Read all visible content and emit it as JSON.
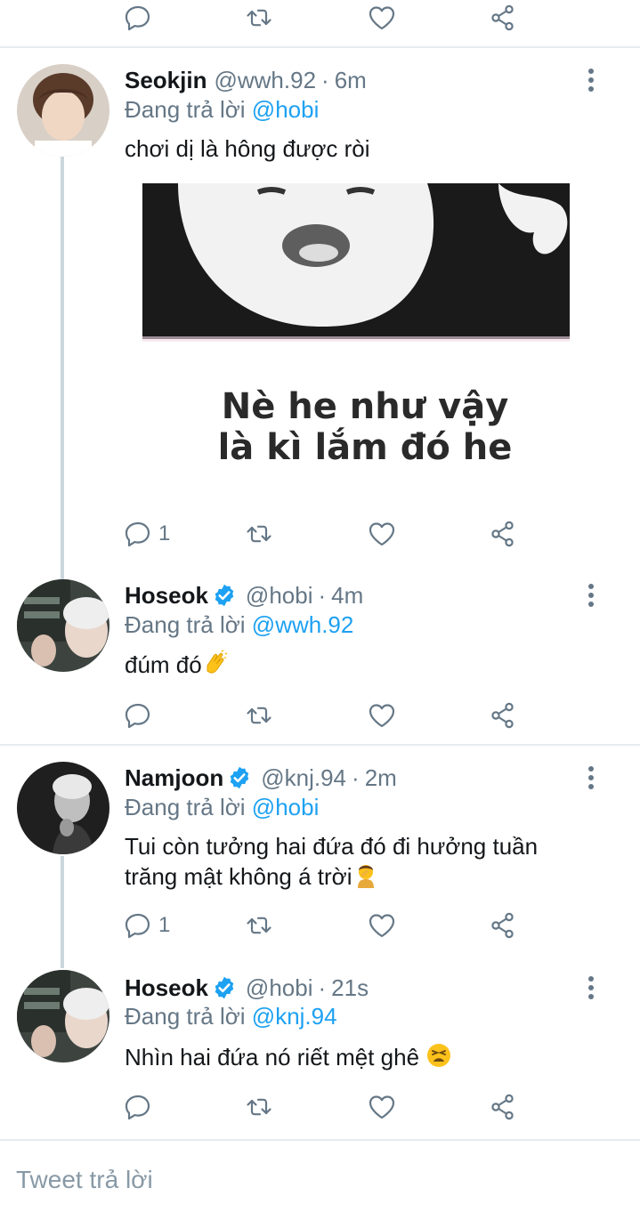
{
  "tweets": [
    {
      "name": "Seokjin",
      "handle": "@wwh.92",
      "time": "6m",
      "verified": false,
      "reply_prefix": "Đang trả lời",
      "reply_to": "@hobi",
      "text": "chơi dị là hông được ròi",
      "media_caption_line1": "Nè he  như vậy",
      "media_caption_line2": "là kì lắm đó he",
      "reply_count": "1"
    },
    {
      "name": "Hoseok",
      "handle": "@hobi",
      "time": "4m",
      "verified": true,
      "reply_prefix": "Đang trả lời",
      "reply_to": "@wwh.92",
      "text": "đúm đó",
      "emoji": "clapping-hands",
      "reply_count": ""
    },
    {
      "name": "Namjoon",
      "handle": "@knj.94",
      "time": "2m",
      "verified": true,
      "reply_prefix": "Đang trả lời",
      "reply_to": "@hobi",
      "text_line1": "Tui còn tưởng hai đứa đó đi hưởng tuần",
      "text_line2": "trăng mật không á trời",
      "emoji": "person-facepalming",
      "reply_count": "1"
    },
    {
      "name": "Hoseok",
      "handle": "@hobi",
      "time": "21s",
      "verified": true,
      "reply_prefix": "Đang trả lời",
      "reply_to": "@knj.94",
      "text": "Nhìn hai đứa nó riết mệt ghê",
      "emoji": "tired-face",
      "reply_count": ""
    }
  ],
  "separator": "·",
  "reply_input_placeholder": "Tweet trả lời",
  "colors": {
    "link": "#1da1f2",
    "secondary_text": "#657786",
    "divider": "#e6ecf0",
    "verified": "#1da1f2"
  },
  "icons": [
    "reply-icon",
    "retweet-icon",
    "like-icon",
    "share-icon",
    "more-icon",
    "verified-icon"
  ]
}
